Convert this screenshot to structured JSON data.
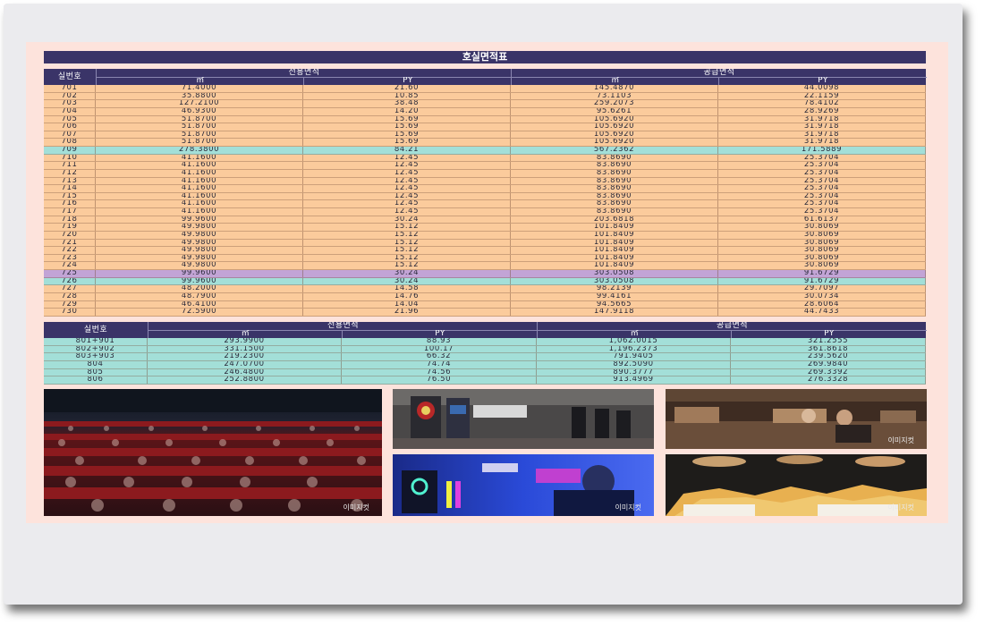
{
  "title": "호실면적표",
  "table1": {
    "headers": {
      "unit": "실번호",
      "exclusive": "전용면적",
      "supply": "공급면적",
      "sqm": "㎡",
      "py": "PY"
    },
    "rows": [
      {
        "unit": "701",
        "e_m2": "71.4000",
        "e_py": "21.60",
        "s_m2": "145.4870",
        "s_py": "44.0098",
        "tone": "orange"
      },
      {
        "unit": "702",
        "e_m2": "35.8800",
        "e_py": "10.85",
        "s_m2": "73.1103",
        "s_py": "22.1159",
        "tone": "orange"
      },
      {
        "unit": "703",
        "e_m2": "127.2100",
        "e_py": "38.48",
        "s_m2": "259.2073",
        "s_py": "78.4102",
        "tone": "orange"
      },
      {
        "unit": "704",
        "e_m2": "46.9300",
        "e_py": "14.20",
        "s_m2": "95.6261",
        "s_py": "28.9269",
        "tone": "orange"
      },
      {
        "unit": "705",
        "e_m2": "51.8700",
        "e_py": "15.69",
        "s_m2": "105.6920",
        "s_py": "31.9718",
        "tone": "orange"
      },
      {
        "unit": "706",
        "e_m2": "51.8700",
        "e_py": "15.69",
        "s_m2": "105.6920",
        "s_py": "31.9718",
        "tone": "orange"
      },
      {
        "unit": "707",
        "e_m2": "51.8700",
        "e_py": "15.69",
        "s_m2": "105.6920",
        "s_py": "31.9718",
        "tone": "orange"
      },
      {
        "unit": "708",
        "e_m2": "51.8700",
        "e_py": "15.69",
        "s_m2": "105.6920",
        "s_py": "31.9718",
        "tone": "orange"
      },
      {
        "unit": "709",
        "e_m2": "278.3800",
        "e_py": "84.21",
        "s_m2": "567.2362",
        "s_py": "171.5889",
        "tone": "teal"
      },
      {
        "unit": "710",
        "e_m2": "41.1600",
        "e_py": "12.45",
        "s_m2": "83.8690",
        "s_py": "25.3704",
        "tone": "orange"
      },
      {
        "unit": "711",
        "e_m2": "41.1600",
        "e_py": "12.45",
        "s_m2": "83.8690",
        "s_py": "25.3704",
        "tone": "orange"
      },
      {
        "unit": "712",
        "e_m2": "41.1600",
        "e_py": "12.45",
        "s_m2": "83.8690",
        "s_py": "25.3704",
        "tone": "orange"
      },
      {
        "unit": "713",
        "e_m2": "41.1600",
        "e_py": "12.45",
        "s_m2": "83.8690",
        "s_py": "25.3704",
        "tone": "orange"
      },
      {
        "unit": "714",
        "e_m2": "41.1600",
        "e_py": "12.45",
        "s_m2": "83.8690",
        "s_py": "25.3704",
        "tone": "orange"
      },
      {
        "unit": "715",
        "e_m2": "41.1600",
        "e_py": "12.45",
        "s_m2": "83.8690",
        "s_py": "25.3704",
        "tone": "orange"
      },
      {
        "unit": "716",
        "e_m2": "41.1600",
        "e_py": "12.45",
        "s_m2": "83.8690",
        "s_py": "25.3704",
        "tone": "orange"
      },
      {
        "unit": "717",
        "e_m2": "41.1600",
        "e_py": "12.45",
        "s_m2": "83.8690",
        "s_py": "25.3704",
        "tone": "orange"
      },
      {
        "unit": "718",
        "e_m2": "99.9600",
        "e_py": "30.24",
        "s_m2": "203.6818",
        "s_py": "61.6137",
        "tone": "orange"
      },
      {
        "unit": "719",
        "e_m2": "49.9800",
        "e_py": "15.12",
        "s_m2": "101.8409",
        "s_py": "30.8069",
        "tone": "orange"
      },
      {
        "unit": "720",
        "e_m2": "49.9800",
        "e_py": "15.12",
        "s_m2": "101.8409",
        "s_py": "30.8069",
        "tone": "orange"
      },
      {
        "unit": "721",
        "e_m2": "49.9800",
        "e_py": "15.12",
        "s_m2": "101.8409",
        "s_py": "30.8069",
        "tone": "orange"
      },
      {
        "unit": "722",
        "e_m2": "49.9800",
        "e_py": "15.12",
        "s_m2": "101.8409",
        "s_py": "30.8069",
        "tone": "orange"
      },
      {
        "unit": "723",
        "e_m2": "49.9800",
        "e_py": "15.12",
        "s_m2": "101.8409",
        "s_py": "30.8069",
        "tone": "orange"
      },
      {
        "unit": "724",
        "e_m2": "49.9800",
        "e_py": "15.12",
        "s_m2": "101.8409",
        "s_py": "30.8069",
        "tone": "orange"
      },
      {
        "unit": "725",
        "e_m2": "99.9600",
        "e_py": "30.24",
        "s_m2": "303.0508",
        "s_py": "91.6729",
        "tone": "purple"
      },
      {
        "unit": "726",
        "e_m2": "99.9600",
        "e_py": "30.24",
        "s_m2": "303.0508",
        "s_py": "91.6729",
        "tone": "teal"
      },
      {
        "unit": "727",
        "e_m2": "48.2000",
        "e_py": "14.58",
        "s_m2": "98.2139",
        "s_py": "29.7097",
        "tone": "orange"
      },
      {
        "unit": "728",
        "e_m2": "48.7900",
        "e_py": "14.76",
        "s_m2": "99.4161",
        "s_py": "30.0734",
        "tone": "orange"
      },
      {
        "unit": "729",
        "e_m2": "46.4100",
        "e_py": "14.04",
        "s_m2": "94.5665",
        "s_py": "28.6064",
        "tone": "orange"
      },
      {
        "unit": "730",
        "e_m2": "72.5900",
        "e_py": "21.96",
        "s_m2": "147.9118",
        "s_py": "44.7433",
        "tone": "orange"
      }
    ]
  },
  "table2": {
    "headers": {
      "unit": "실번호",
      "exclusive": "전용면적",
      "supply": "공급면적",
      "sqm": "㎡",
      "py": "PY"
    },
    "rows": [
      {
        "unit": "801+901",
        "e_m2": "293.9900",
        "e_py": "88.93",
        "s_m2": "1,062.0015",
        "s_py": "321.2555",
        "tone": "teal"
      },
      {
        "unit": "802+902",
        "e_m2": "331.1500",
        "e_py": "100.17",
        "s_m2": "1,196.2373",
        "s_py": "361.8618",
        "tone": "teal"
      },
      {
        "unit": "803+903",
        "e_m2": "219.2300",
        "e_py": "66.32",
        "s_m2": "791.9405",
        "s_py": "239.5620",
        "tone": "teal"
      },
      {
        "unit": "804",
        "e_m2": "247.0700",
        "e_py": "74.74",
        "s_m2": "892.5090",
        "s_py": "269.9840",
        "tone": "teal"
      },
      {
        "unit": "805",
        "e_m2": "246.4800",
        "e_py": "74.56",
        "s_m2": "890.3777",
        "s_py": "269.3392",
        "tone": "teal"
      },
      {
        "unit": "806",
        "e_m2": "252.8800",
        "e_py": "76.50",
        "s_m2": "913.4969",
        "s_py": "276.3328",
        "tone": "teal"
      }
    ]
  },
  "photos": {
    "caption": "이미지컷",
    "theater": "cinema-audience-photo",
    "arcade": "arcade-darts-photo",
    "lounge": "lounge-dining-photo",
    "vr": "vr-gaming-photo",
    "food": "nachos-food-photo"
  },
  "colors": {
    "header": "#3a3468",
    "orange_row": "#fbcb9c",
    "teal_row": "#a3dfd8",
    "purple_row": "#c2a4d6",
    "sheet": "#fde3dc"
  }
}
